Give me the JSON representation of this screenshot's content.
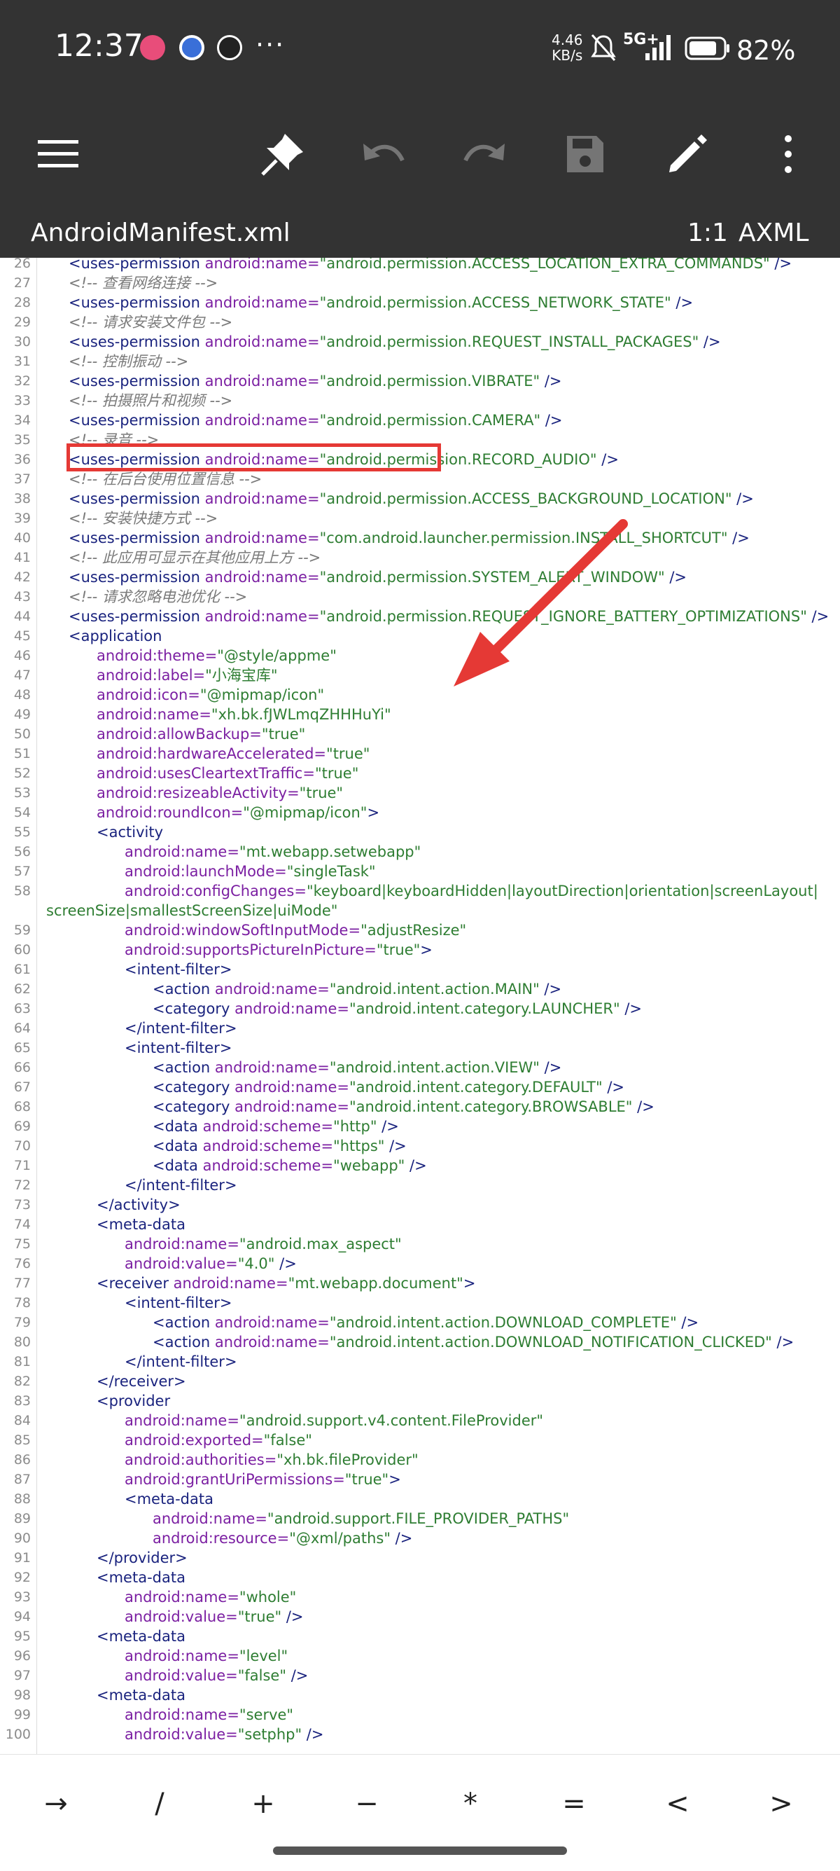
{
  "status": {
    "time": "12:37",
    "more": "···",
    "net_speed": "4.46",
    "net_unit": "KB/s",
    "signal": "5G+",
    "battery": "82%"
  },
  "file": {
    "name": "AndroidManifest.xml",
    "position": "1:1",
    "mode": "AXML"
  },
  "lines": [
    {
      "n": "26",
      "i": 0,
      "parts": [
        [
          "t",
          "<uses-permission "
        ],
        [
          "a",
          "android:name="
        ],
        [
          "v",
          "\"android.permission.ACCESS_LOCATION_EXTRA_COMMANDS\""
        ],
        [
          "t",
          " />"
        ]
      ]
    },
    {
      "n": "27",
      "i": 0,
      "parts": [
        [
          "c",
          "<!-- 查看网络连接 -->"
        ]
      ]
    },
    {
      "n": "28",
      "i": 0,
      "parts": [
        [
          "t",
          "<uses-permission "
        ],
        [
          "a",
          "android:name="
        ],
        [
          "v",
          "\"android.permission.ACCESS_NETWORK_STATE\""
        ],
        [
          "t",
          " />"
        ]
      ]
    },
    {
      "n": "29",
      "i": 0,
      "parts": [
        [
          "c",
          "<!-- 请求安装文件包 -->"
        ]
      ]
    },
    {
      "n": "30",
      "i": 0,
      "parts": [
        [
          "t",
          "<uses-permission "
        ],
        [
          "a",
          "android:name="
        ],
        [
          "v",
          "\"android.permission.REQUEST_INSTALL_PACKAGES\""
        ],
        [
          "t",
          " />"
        ]
      ]
    },
    {
      "n": "31",
      "i": 0,
      "parts": [
        [
          "c",
          "<!-- 控制振动 -->"
        ]
      ]
    },
    {
      "n": "32",
      "i": 0,
      "parts": [
        [
          "t",
          "<uses-permission "
        ],
        [
          "a",
          "android:name="
        ],
        [
          "v",
          "\"android.permission.VIBRATE\""
        ],
        [
          "t",
          " />"
        ]
      ]
    },
    {
      "n": "33",
      "i": 0,
      "parts": [
        [
          "c",
          "<!-- 拍摄照片和视频 -->"
        ]
      ]
    },
    {
      "n": "34",
      "i": 0,
      "parts": [
        [
          "t",
          "<uses-permission "
        ],
        [
          "a",
          "android:name="
        ],
        [
          "v",
          "\"android.permission.CAMERA\""
        ],
        [
          "t",
          " />"
        ]
      ]
    },
    {
      "n": "35",
      "i": 0,
      "parts": [
        [
          "c",
          "<!-- 录音 -->"
        ]
      ]
    },
    {
      "n": "36",
      "i": 0,
      "parts": [
        [
          "t",
          "<uses-permission "
        ],
        [
          "a",
          "android:name="
        ],
        [
          "v",
          "\"android.permission.RECORD_AUDIO\""
        ],
        [
          "t",
          " />"
        ]
      ]
    },
    {
      "n": "37",
      "i": 0,
      "parts": [
        [
          "c",
          "<!-- 在后台使用位置信息 -->"
        ]
      ]
    },
    {
      "n": "38",
      "i": 0,
      "parts": [
        [
          "t",
          "<uses-permission "
        ],
        [
          "a",
          "android:name="
        ],
        [
          "v",
          "\"android.permission.ACCESS_BACKGROUND_LOCATION\""
        ],
        [
          "t",
          " />"
        ]
      ]
    },
    {
      "n": "39",
      "i": 0,
      "parts": [
        [
          "c",
          "<!-- 安装快捷方式 -->"
        ]
      ]
    },
    {
      "n": "40",
      "i": 0,
      "parts": [
        [
          "t",
          "<uses-permission "
        ],
        [
          "a",
          "android:name="
        ],
        [
          "v",
          "\"com.android.launcher.permission.INSTALL_SHORTCUT\""
        ],
        [
          "t",
          " />"
        ]
      ]
    },
    {
      "n": "41",
      "i": 0,
      "parts": [
        [
          "c",
          "<!-- 此应用可显示在其他应用上方 -->"
        ]
      ]
    },
    {
      "n": "42",
      "i": 0,
      "parts": [
        [
          "t",
          "<uses-permission "
        ],
        [
          "a",
          "android:name="
        ],
        [
          "v",
          "\"android.permission.SYSTEM_ALERT_WINDOW\""
        ],
        [
          "t",
          " />"
        ]
      ]
    },
    {
      "n": "43",
      "i": 0,
      "parts": [
        [
          "c",
          "<!-- 请求忽略电池优化 -->"
        ]
      ]
    },
    {
      "n": "44",
      "i": 0,
      "parts": [
        [
          "t",
          "<uses-permission "
        ],
        [
          "a",
          "android:name="
        ],
        [
          "v",
          "\"android.permission.REQUEST_IGNORE_BATTERY_OPTIMIZATIONS\""
        ],
        [
          "t",
          " />"
        ]
      ]
    },
    {
      "n": "45",
      "i": 0,
      "parts": [
        [
          "t",
          "<application"
        ]
      ]
    },
    {
      "n": "46",
      "i": 1,
      "parts": [
        [
          "a",
          "android:theme="
        ],
        [
          "v",
          "\"@style/appme\""
        ]
      ]
    },
    {
      "n": "47",
      "i": 1,
      "parts": [
        [
          "a",
          "android:label="
        ],
        [
          "v",
          "\"小海宝库\""
        ]
      ]
    },
    {
      "n": "48",
      "i": 1,
      "parts": [
        [
          "a",
          "android:icon="
        ],
        [
          "v",
          "\"@mipmap/icon\""
        ]
      ]
    },
    {
      "n": "49",
      "i": 1,
      "parts": [
        [
          "a",
          "android:name="
        ],
        [
          "v",
          "\"xh.bk.fJWLmqZHHHuYi\""
        ]
      ]
    },
    {
      "n": "50",
      "i": 1,
      "parts": [
        [
          "a",
          "android:allowBackup="
        ],
        [
          "v",
          "\"true\""
        ]
      ]
    },
    {
      "n": "51",
      "i": 1,
      "parts": [
        [
          "a",
          "android:hardwareAccelerated="
        ],
        [
          "v",
          "\"true\""
        ]
      ]
    },
    {
      "n": "52",
      "i": 1,
      "parts": [
        [
          "a",
          "android:usesCleartextTraffic="
        ],
        [
          "v",
          "\"true\""
        ]
      ]
    },
    {
      "n": "53",
      "i": 1,
      "parts": [
        [
          "a",
          "android:resizeableActivity="
        ],
        [
          "v",
          "\"true\""
        ]
      ]
    },
    {
      "n": "54",
      "i": 1,
      "parts": [
        [
          "a",
          "android:roundIcon="
        ],
        [
          "v",
          "\"@mipmap/icon\""
        ],
        [
          "t",
          ">"
        ]
      ]
    },
    {
      "n": "55",
      "i": 1,
      "parts": [
        [
          "t",
          "<activity"
        ]
      ]
    },
    {
      "n": "56",
      "i": 2,
      "parts": [
        [
          "a",
          "android:name="
        ],
        [
          "v",
          "\"mt.webapp.setwebapp\""
        ]
      ]
    },
    {
      "n": "57",
      "i": 2,
      "parts": [
        [
          "a",
          "android:launchMode="
        ],
        [
          "v",
          "\"singleTask\""
        ]
      ]
    },
    {
      "n": "58",
      "i": 2,
      "parts": [
        [
          "a",
          "android:configChanges="
        ],
        [
          "v",
          "\"keyboard|keyboardHidden|layoutDirection|orientation|screenLayout|"
        ]
      ]
    },
    {
      "n": "",
      "i": -1,
      "parts": [
        [
          "v",
          "screenSize|smallestScreenSize|uiMode\""
        ]
      ]
    },
    {
      "n": "59",
      "i": 2,
      "parts": [
        [
          "a",
          "android:windowSoftInputMode="
        ],
        [
          "v",
          "\"adjustResize\""
        ]
      ]
    },
    {
      "n": "60",
      "i": 2,
      "parts": [
        [
          "a",
          "android:supportsPictureInPicture="
        ],
        [
          "v",
          "\"true\""
        ],
        [
          "t",
          ">"
        ]
      ]
    },
    {
      "n": "61",
      "i": 2,
      "parts": [
        [
          "t",
          "<intent-filter>"
        ]
      ]
    },
    {
      "n": "62",
      "i": 3,
      "parts": [
        [
          "t",
          "<action "
        ],
        [
          "a",
          "android:name="
        ],
        [
          "v",
          "\"android.intent.action.MAIN\""
        ],
        [
          "t",
          " />"
        ]
      ]
    },
    {
      "n": "63",
      "i": 3,
      "parts": [
        [
          "t",
          "<category "
        ],
        [
          "a",
          "android:name="
        ],
        [
          "v",
          "\"android.intent.category.LAUNCHER\""
        ],
        [
          "t",
          " />"
        ]
      ]
    },
    {
      "n": "64",
      "i": 2,
      "parts": [
        [
          "t",
          "</intent-filter>"
        ]
      ]
    },
    {
      "n": "65",
      "i": 2,
      "parts": [
        [
          "t",
          "<intent-filter>"
        ]
      ]
    },
    {
      "n": "66",
      "i": 3,
      "parts": [
        [
          "t",
          "<action "
        ],
        [
          "a",
          "android:name="
        ],
        [
          "v",
          "\"android.intent.action.VIEW\""
        ],
        [
          "t",
          " />"
        ]
      ]
    },
    {
      "n": "67",
      "i": 3,
      "parts": [
        [
          "t",
          "<category "
        ],
        [
          "a",
          "android:name="
        ],
        [
          "v",
          "\"android.intent.category.DEFAULT\""
        ],
        [
          "t",
          " />"
        ]
      ]
    },
    {
      "n": "68",
      "i": 3,
      "parts": [
        [
          "t",
          "<category "
        ],
        [
          "a",
          "android:name="
        ],
        [
          "v",
          "\"android.intent.category.BROWSABLE\""
        ],
        [
          "t",
          " />"
        ]
      ]
    },
    {
      "n": "69",
      "i": 3,
      "parts": [
        [
          "t",
          "<data "
        ],
        [
          "a",
          "android:scheme="
        ],
        [
          "v",
          "\"http\""
        ],
        [
          "t",
          " />"
        ]
      ]
    },
    {
      "n": "70",
      "i": 3,
      "parts": [
        [
          "t",
          "<data "
        ],
        [
          "a",
          "android:scheme="
        ],
        [
          "v",
          "\"https\""
        ],
        [
          "t",
          " />"
        ]
      ]
    },
    {
      "n": "71",
      "i": 3,
      "parts": [
        [
          "t",
          "<data "
        ],
        [
          "a",
          "android:scheme="
        ],
        [
          "v",
          "\"webapp\""
        ],
        [
          "t",
          " />"
        ]
      ]
    },
    {
      "n": "72",
      "i": 2,
      "parts": [
        [
          "t",
          "</intent-filter>"
        ]
      ]
    },
    {
      "n": "73",
      "i": 1,
      "parts": [
        [
          "t",
          "</activity>"
        ]
      ]
    },
    {
      "n": "74",
      "i": 1,
      "parts": [
        [
          "t",
          "<meta-data"
        ]
      ]
    },
    {
      "n": "75",
      "i": 2,
      "parts": [
        [
          "a",
          "android:name="
        ],
        [
          "v",
          "\"android.max_aspect\""
        ]
      ]
    },
    {
      "n": "76",
      "i": 2,
      "parts": [
        [
          "a",
          "android:value="
        ],
        [
          "v",
          "\"4.0\""
        ],
        [
          "t",
          " />"
        ]
      ]
    },
    {
      "n": "77",
      "i": 1,
      "parts": [
        [
          "t",
          "<receiver "
        ],
        [
          "a",
          "android:name="
        ],
        [
          "v",
          "\"mt.webapp.document\""
        ],
        [
          "t",
          ">"
        ]
      ]
    },
    {
      "n": "78",
      "i": 2,
      "parts": [
        [
          "t",
          "<intent-filter>"
        ]
      ]
    },
    {
      "n": "79",
      "i": 3,
      "parts": [
        [
          "t",
          "<action "
        ],
        [
          "a",
          "android:name="
        ],
        [
          "v",
          "\"android.intent.action.DOWNLOAD_COMPLETE\""
        ],
        [
          "t",
          " />"
        ]
      ]
    },
    {
      "n": "80",
      "i": 3,
      "parts": [
        [
          "t",
          "<action "
        ],
        [
          "a",
          "android:name="
        ],
        [
          "v",
          "\"android.intent.action.DOWNLOAD_NOTIFICATION_CLICKED\""
        ],
        [
          "t",
          " />"
        ]
      ]
    },
    {
      "n": "81",
      "i": 2,
      "parts": [
        [
          "t",
          "</intent-filter>"
        ]
      ]
    },
    {
      "n": "82",
      "i": 1,
      "parts": [
        [
          "t",
          "</receiver>"
        ]
      ]
    },
    {
      "n": "83",
      "i": 1,
      "parts": [
        [
          "t",
          "<provider"
        ]
      ]
    },
    {
      "n": "84",
      "i": 2,
      "parts": [
        [
          "a",
          "android:name="
        ],
        [
          "v",
          "\"android.support.v4.content.FileProvider\""
        ]
      ]
    },
    {
      "n": "85",
      "i": 2,
      "parts": [
        [
          "a",
          "android:exported="
        ],
        [
          "v",
          "\"false\""
        ]
      ]
    },
    {
      "n": "86",
      "i": 2,
      "parts": [
        [
          "a",
          "android:authorities="
        ],
        [
          "v",
          "\"xh.bk.fileProvider\""
        ]
      ]
    },
    {
      "n": "87",
      "i": 2,
      "parts": [
        [
          "a",
          "android:grantUriPermissions="
        ],
        [
          "v",
          "\"true\""
        ],
        [
          "t",
          ">"
        ]
      ]
    },
    {
      "n": "88",
      "i": 2,
      "parts": [
        [
          "t",
          "<meta-data"
        ]
      ]
    },
    {
      "n": "89",
      "i": 3,
      "parts": [
        [
          "a",
          "android:name="
        ],
        [
          "v",
          "\"android.support.FILE_PROVIDER_PATHS\""
        ]
      ]
    },
    {
      "n": "90",
      "i": 3,
      "parts": [
        [
          "a",
          "android:resource="
        ],
        [
          "v",
          "\"@xml/paths\""
        ],
        [
          "t",
          " />"
        ]
      ]
    },
    {
      "n": "91",
      "i": 1,
      "parts": [
        [
          "t",
          "</provider>"
        ]
      ]
    },
    {
      "n": "92",
      "i": 1,
      "parts": [
        [
          "t",
          "<meta-data"
        ]
      ]
    },
    {
      "n": "93",
      "i": 2,
      "parts": [
        [
          "a",
          "android:name="
        ],
        [
          "v",
          "\"whole\""
        ]
      ]
    },
    {
      "n": "94",
      "i": 2,
      "parts": [
        [
          "a",
          "android:value="
        ],
        [
          "v",
          "\"true\""
        ],
        [
          "t",
          " />"
        ]
      ]
    },
    {
      "n": "95",
      "i": 1,
      "parts": [
        [
          "t",
          "<meta-data"
        ]
      ]
    },
    {
      "n": "96",
      "i": 2,
      "parts": [
        [
          "a",
          "android:name="
        ],
        [
          "v",
          "\"level\""
        ]
      ]
    },
    {
      "n": "97",
      "i": 2,
      "parts": [
        [
          "a",
          "android:value="
        ],
        [
          "v",
          "\"false\""
        ],
        [
          "t",
          " />"
        ]
      ]
    },
    {
      "n": "98",
      "i": 1,
      "parts": [
        [
          "t",
          "<meta-data"
        ]
      ]
    },
    {
      "n": "99",
      "i": 2,
      "parts": [
        [
          "a",
          "android:name="
        ],
        [
          "v",
          "\"serve\""
        ]
      ]
    },
    {
      "n": "100",
      "i": 2,
      "parts": [
        [
          "a",
          "android:value="
        ],
        [
          "v",
          "\"setphp\""
        ],
        [
          "t",
          " />"
        ]
      ]
    }
  ],
  "keys": [
    "→",
    "/",
    "+",
    "−",
    "*",
    "=",
    "<",
    ">"
  ],
  "colors": {
    "bar": "#333333",
    "highlight": "#e53935",
    "tag": "#1a237e",
    "attr": "#7b1fa2",
    "value": "#2e7d32",
    "comment": "#7a7a7a"
  }
}
